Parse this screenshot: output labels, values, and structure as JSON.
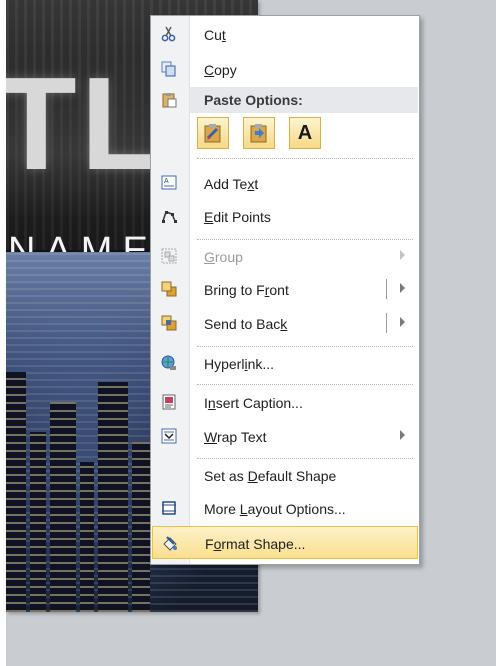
{
  "menu": {
    "items": [
      {
        "label_pre": "Cu",
        "label_ul": "t",
        "label_post": "",
        "icon": "scissors-icon"
      },
      {
        "label_pre": "",
        "label_ul": "C",
        "label_post": "opy",
        "icon": "copy-icon"
      },
      {
        "section": "Paste Options:",
        "icon": "clipboard-icon"
      },
      {
        "label_pre": "Add Te",
        "label_ul": "x",
        "label_post": "t",
        "icon": "text-box-icon"
      },
      {
        "label_pre": "",
        "label_ul": "E",
        "label_post": "dit Points",
        "icon": "edit-points-icon"
      },
      {
        "label_pre": "",
        "label_ul": "G",
        "label_post": "roup",
        "icon": "group-icon",
        "disabled": true
      },
      {
        "label_pre": "Bring to F",
        "label_ul": "r",
        "label_post": "ont",
        "icon": "bring-to-front-icon"
      },
      {
        "label_pre": "Send to Bac",
        "label_ul": "k",
        "label_post": "",
        "icon": "send-to-back-icon"
      },
      {
        "label_pre": "Hyperl",
        "label_ul": "i",
        "label_post": "nk...",
        "icon": "hyperlink-icon"
      },
      {
        "label_pre": "I",
        "label_ul": "n",
        "label_post": "sert Caption...",
        "icon": "insert-caption-icon"
      },
      {
        "label_pre": "",
        "label_ul": "W",
        "label_post": "rap Text",
        "icon": "wrap-text-icon"
      },
      {
        "label_pre": "Set as ",
        "label_ul": "D",
        "label_post": "efault Shape",
        "icon": ""
      },
      {
        "label_pre": "More ",
        "label_ul": "L",
        "label_post": "ayout Options...",
        "icon": "layout-options-icon"
      },
      {
        "label_pre": "F",
        "label_ul": "o",
        "label_post": "rmat Shape...",
        "icon": "format-shape-icon"
      }
    ],
    "paste_options": [
      "keep-source-formatting-icon",
      "use-destination-icon",
      "keep-text-only-icon"
    ],
    "paste_text_only_glyph": "A"
  },
  "slide": {
    "title_fragment": "TLE",
    "name_fragment": "NAME"
  },
  "colors": {
    "highlight": "#fbdf8f",
    "menu_bg": "#ffffff",
    "gutter": "#f1f2f4"
  }
}
